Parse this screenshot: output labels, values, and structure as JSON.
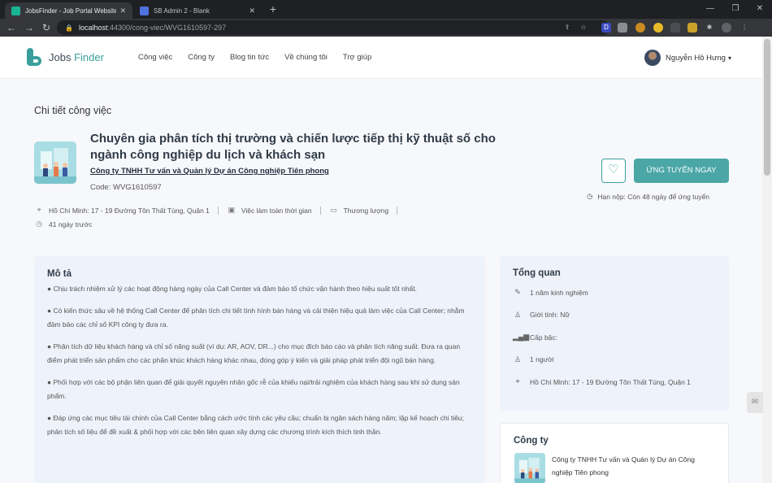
{
  "browser": {
    "tabs": [
      {
        "title": "JobsFinder - Job Portal Website T",
        "active": true
      },
      {
        "title": "SB Admin 2 - Blank",
        "active": false
      }
    ],
    "url_host": "localhost",
    "url_path": ":44300/cong-viec/WVG1610597-297"
  },
  "header": {
    "logo_text": "Jobs",
    "logo_accent": "Finder",
    "nav": [
      "Công việc",
      "Công ty",
      "Blog tin tức",
      "Về chúng tôi",
      "Trợ giúp"
    ],
    "user_name": "Nguyễn Hồ Hưng"
  },
  "job": {
    "page_subtitle": "Chi tiết công việc",
    "title": "Chuyên gia phân tích thị trường và chiến lược tiếp thị kỹ thuật số cho ngành công nghiệp du lịch và khách sạn",
    "company": "Công ty TNHH Tư vấn và Quản lý Dự án Công nghiệp Tiên phong",
    "code": "Code: WVG1610597",
    "location": "Hồ Chí Minh: 17 - 19 Đường Tôn Thất Tùng, Quận 1",
    "job_type": "Việc làm toàn thời gian",
    "salary": "Thương lượng",
    "posted": "41 ngày trước",
    "apply_label": "ỨNG TUYỂN NGAY",
    "deadline": "Hạn nộp: Còn 48 ngày để ứng tuyển"
  },
  "description": {
    "title": "Mô tả",
    "paragraphs": [
      "● Chịu trách nhiệm xử lý các hoạt động hàng ngày của Call Center và đảm bảo tổ chức vận hành theo hiệu suất tốt nhất.",
      "● Có kiến thức sâu về hệ thống Call Center để phân tích chi tiết tình hình bán hàng và cải thiện hiệu quả làm việc của Call Center; nhằm đảm bảo các chỉ số KPI công ty đưa ra.",
      "● Phân tích dữ liệu khách hàng và chỉ số năng suất (ví dụ: AR, AOV, DR...) cho mục đích báo cáo và phân tích năng suất. Đưa ra quan điểm phát triển sản phẩm cho các phân khúc khách hàng khác nhau, đóng góp ý kiến và giải pháp phát triển đội ngũ bán hàng.",
      "● Phối hợp với các bộ phận liên quan để giải quyết nguyên nhân gốc rễ của khiếu nại/trải nghiệm của khách hàng sau khi sử dụng sản phẩm.",
      "● Đáp ứng các mục tiêu tài chính của Call Center bằng cách ước tính các yêu cầu; chuẩn bị ngân sách hàng năm; lập kế hoạch chi tiêu; phân tích số liệu để đề xuất & phối hợp với các bên liên quan xây dựng các chương trình kích thích tinh thần."
    ]
  },
  "overview": {
    "title": "Tổng quan",
    "items": [
      {
        "icon": "pencil-icon",
        "text": "1 năm kinh nghiệm"
      },
      {
        "icon": "user-gender-icon",
        "text": "Giới tính: Nữ"
      },
      {
        "icon": "level-bars-icon",
        "text": "Cấp bậc:"
      },
      {
        "icon": "users-icon",
        "text": "1 người"
      },
      {
        "icon": "location-pin-icon",
        "text": "Hồ Chí Minh: 17 - 19 Đường Tôn Thất Tùng, Quận 1"
      }
    ]
  },
  "company_card": {
    "title": "Công ty",
    "name": "Công ty TNHH Tư vấn và Quản lý Dự án Công nghiệp Tiên phong"
  },
  "colors": {
    "accent": "#3a9f9c",
    "apply_button": "#4aa7a6",
    "card_bg": "#eef2fa"
  }
}
